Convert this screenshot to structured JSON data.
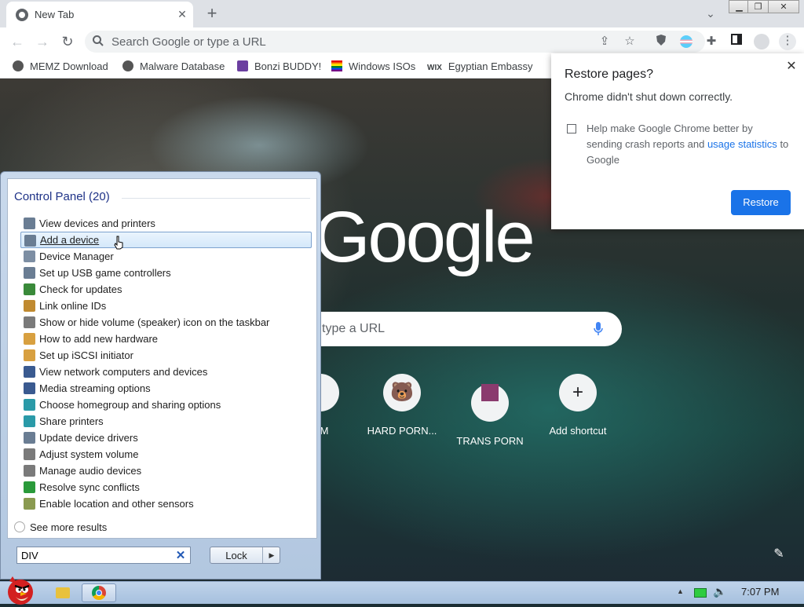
{
  "browser": {
    "tab_title": "New Tab",
    "omnibox_placeholder": "Search Google or type a URL",
    "bookmarks": [
      "MEMZ Download",
      "Malware Database",
      "Bonzi BUDDY!",
      "Windows ISOs",
      "Egyptian Embassy"
    ]
  },
  "ntp": {
    "logo_text": "Google",
    "search_placeholder": "type a URL",
    "shortcuts": [
      {
        "label": "OM",
        "icon": "truncated-shortcut-icon"
      },
      {
        "label": "HARD PORN...",
        "icon": "bear-icon"
      },
      {
        "label": "TRANS PORN",
        "icon": "thumbnail-icon"
      },
      {
        "label": "Add shortcut",
        "icon": "plus-icon",
        "glyph": "+"
      }
    ]
  },
  "restore_dialog": {
    "title": "Restore pages?",
    "message": "Chrome didn't shut down correctly.",
    "checkbox_text_1": "Help make Google Chrome better by sending crash reports and",
    "checkbox_link": "usage statistics",
    "checkbox_text_2": "to Google",
    "checkbox_checked": false,
    "button_label": "Restore"
  },
  "start_menu": {
    "results_header": "Control Panel (20)",
    "items": [
      "View devices and printers",
      "Add a device",
      "Device Manager",
      "Set up USB game controllers",
      "Check for updates",
      "Link online IDs",
      "Show or hide volume (speaker) icon on the taskbar",
      "How to add new hardware",
      "Set up iSCSI initiator",
      "View network computers and devices",
      "Media streaming options",
      "Choose homegroup and sharing options",
      "Share printers",
      "Update device drivers",
      "Adjust system volume",
      "Manage audio devices",
      "Resolve sync conflicts",
      "Enable location and other sensors"
    ],
    "selected_index": 1,
    "see_more": "See more results",
    "search_value": "DIV",
    "lock_label": "Lock"
  },
  "taskbar": {
    "clock": "7:07 PM"
  },
  "colors": {
    "chrome_blue": "#1a73e8",
    "start_menu_header": "#1e3287",
    "taskbar": "#a6c0de"
  }
}
